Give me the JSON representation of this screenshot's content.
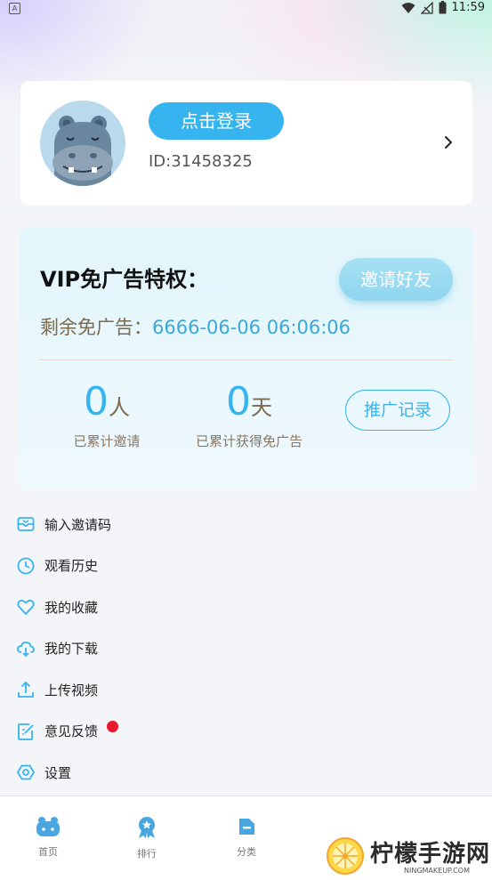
{
  "status_bar": {
    "time": "11:59"
  },
  "profile": {
    "login_label": "点击登录",
    "user_id": "ID:31458325"
  },
  "vip": {
    "title": "VIP免广告特权：",
    "invite_label": "邀请好友",
    "remain_label": "剩余免广告：",
    "remain_value": "6666-06-06 06:06:06",
    "invited_count": "0",
    "invited_unit": "人",
    "invited_label": "已累计邀请",
    "days_count": "0",
    "days_unit": "天",
    "days_label": "已累计获得免广告",
    "record_label": "推广记录"
  },
  "menu": {
    "items": [
      {
        "label": "输入邀请码",
        "icon": "invite-code-icon"
      },
      {
        "label": "观看历史",
        "icon": "clock-icon"
      },
      {
        "label": "我的收藏",
        "icon": "heart-icon"
      },
      {
        "label": "我的下载",
        "icon": "cloud-download-icon"
      },
      {
        "label": "上传视频",
        "icon": "upload-icon"
      },
      {
        "label": "意见反馈",
        "icon": "feedback-icon"
      },
      {
        "label": "设置",
        "icon": "settings-icon"
      }
    ]
  },
  "nav": {
    "items": [
      {
        "label": "首页",
        "icon": "home-hippo-icon"
      },
      {
        "label": "排行",
        "icon": "rank-badge-icon"
      },
      {
        "label": "分类",
        "icon": "category-icon"
      }
    ]
  },
  "watermark": {
    "text": "柠檬手游网",
    "subtext": "NINGMAKEUP.COM"
  },
  "colors": {
    "accent": "#36b4f0",
    "vip_text": "#7a6a4e",
    "red_dot": "#e8192c"
  }
}
